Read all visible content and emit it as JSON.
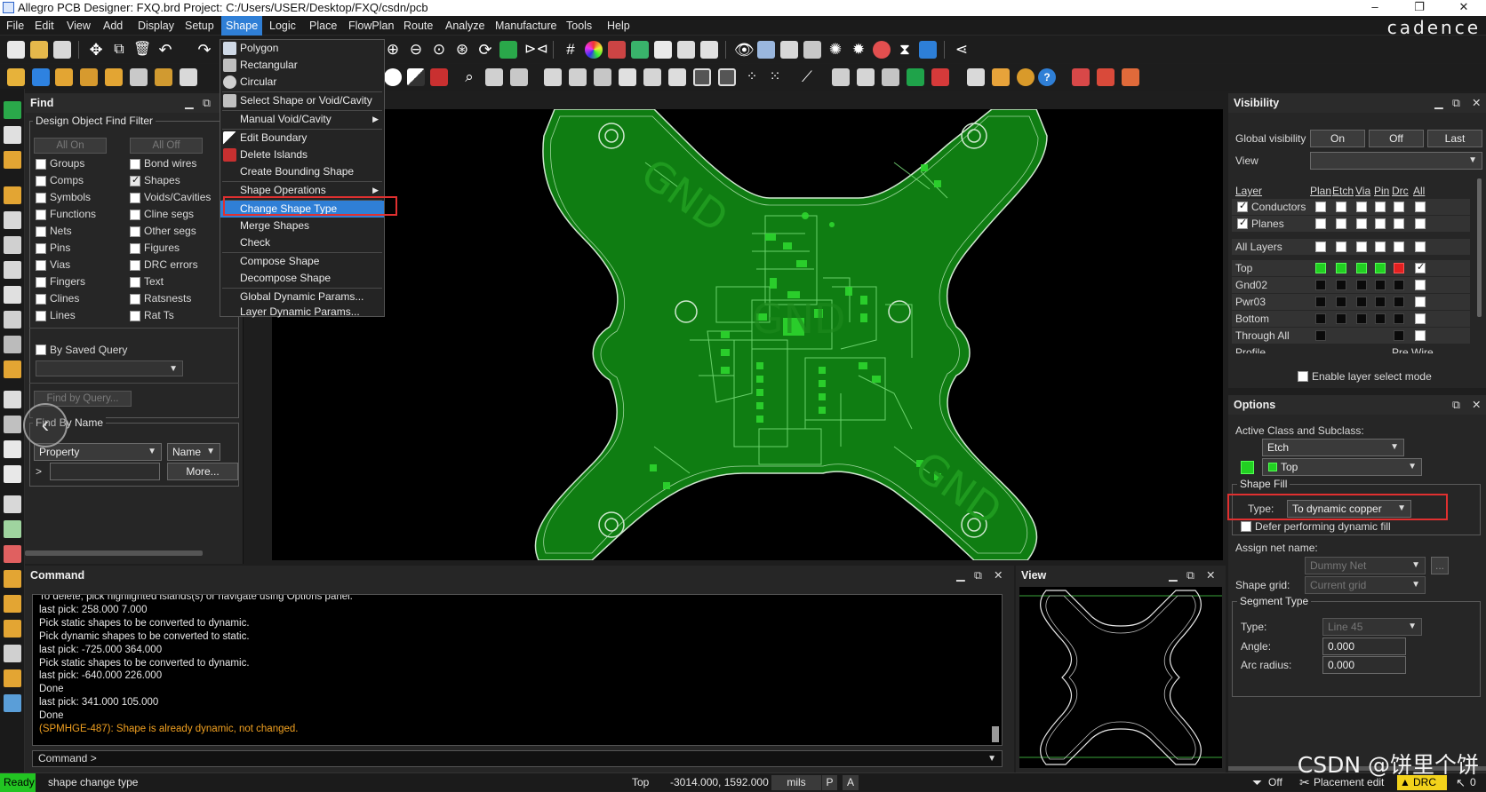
{
  "window": {
    "title": "Allegro PCB Designer: FXQ.brd  Project: C:/Users/USER/Desktop/FXQ/csdn/pcb",
    "minimize": "–",
    "restore": "❐",
    "close": "✕"
  },
  "menubar": {
    "items": [
      "File",
      "Edit",
      "View",
      "Add",
      "Display",
      "Setup",
      "Shape",
      "Logic",
      "Place",
      "FlowPlan",
      "Route",
      "Analyze",
      "Manufacture",
      "Tools",
      "Help"
    ],
    "active": "Shape",
    "brand": "cadence"
  },
  "shape_menu": {
    "items": [
      {
        "label": "Polygon"
      },
      {
        "label": "Rectangular"
      },
      {
        "label": "Circular"
      },
      {
        "label": "Select Shape or Void/Cavity"
      },
      {
        "label": "Manual Void/Cavity"
      },
      {
        "label": "Edit Boundary"
      },
      {
        "label": "Delete Islands"
      },
      {
        "label": "Create Bounding Shape"
      },
      {
        "label": "Shape Operations"
      },
      {
        "label": "Change Shape Type"
      },
      {
        "label": "Merge Shapes"
      },
      {
        "label": "Check"
      },
      {
        "label": "Compose Shape"
      },
      {
        "label": "Decompose Shape"
      },
      {
        "label": "Global Dynamic Params..."
      },
      {
        "label": "Layer Dynamic Params..."
      }
    ],
    "selected": "Change Shape Type"
  },
  "find": {
    "title": "Find",
    "filter_legend": "Design Object Find Filter",
    "all_on": "All On",
    "all_off": "All Off",
    "left_items": [
      "Groups",
      "Comps",
      "Symbols",
      "Functions",
      "Nets",
      "Pins",
      "Vias",
      "Fingers",
      "Clines",
      "Lines"
    ],
    "right_items": [
      "Bond wires",
      "Shapes",
      "Voids/Cavities",
      "Cline segs",
      "Other segs",
      "Figures",
      "DRC errors",
      "Text",
      "Ratsnests",
      "Rat Ts"
    ],
    "checked": [
      "Shapes"
    ],
    "by_saved_query": "By Saved Query",
    "find_by_query": "Find by Query...",
    "find_by_name_legend": "Find By Name",
    "property": "Property",
    "name": "Name",
    "prompt": ">",
    "more": "More..."
  },
  "visibility": {
    "title": "Visibility",
    "global_label": "Global visibility",
    "on": "On",
    "off": "Off",
    "last": "Last",
    "view_label": "View",
    "columns": [
      "Layer",
      "Plan",
      "Etch",
      "Via",
      "Pin",
      "Drc",
      "All"
    ],
    "rows": [
      {
        "name": "Conductors",
        "checked": true
      },
      {
        "name": "Planes",
        "checked": true
      },
      {
        "name": "All Layers"
      },
      {
        "name": "Top"
      },
      {
        "name": "Gnd02"
      },
      {
        "name": "Pwr03"
      },
      {
        "name": "Bottom"
      },
      {
        "name": "Through All"
      }
    ],
    "partial_row_left": "Profile",
    "partial_row_right": "Pre Wire",
    "enable_layer_select": "Enable layer select mode"
  },
  "options": {
    "title": "Options",
    "active_class_label": "Active Class and Subclass:",
    "class_value": "Etch",
    "subclass_value": "Top",
    "shape_fill_legend": "Shape Fill",
    "type_label": "Type:",
    "type_value": "To dynamic copper",
    "defer_label": "Defer performing dynamic fill",
    "assign_net_label": "Assign net name:",
    "net_value": "Dummy Net",
    "net_button": "...",
    "shape_grid_label": "Shape grid:",
    "grid_value": "Current grid",
    "segment_legend": "Segment Type",
    "seg_type_label": "Type:",
    "seg_type_value": "Line 45",
    "angle_label": "Angle:",
    "angle_value": "0.000",
    "arc_label": "Arc radius:",
    "arc_value": "0.000"
  },
  "command": {
    "title": "Command",
    "lines": [
      "To delete, pick highlighted islands(s) or navigate using Options panel.",
      "last pick:  258.000 7.000",
      "Pick static shapes to be converted to dynamic.",
      "Pick dynamic shapes to be converted to static.",
      "last pick:  -725.000 364.000",
      "Pick static shapes to be converted to dynamic.",
      "last pick:  -640.000 226.000",
      "Done",
      "last pick:  341.000 105.000",
      "Done"
    ],
    "warning": "(SPMHGE-487): Shape is already dynamic, not changed.",
    "prompt": "Command >"
  },
  "view_panel": {
    "title": "View"
  },
  "status": {
    "state": "Ready",
    "command": "shape change type",
    "layer": "Top",
    "coords": "-3014.000, 1592.000",
    "units": "mils",
    "p": "P",
    "a": "A",
    "off": "Off",
    "mode": "Placement edit",
    "drc": "DRC",
    "count": "0"
  },
  "board_text": {
    "top_left": "GND",
    "bottom_right": "GND",
    "center": "GND"
  },
  "watermark": "CSDN @饼里个饼",
  "colors": {
    "accent": "#2f7fd6",
    "copper": "#0f8a0f",
    "highlight_box": "#e03030",
    "warning": "#f0a020"
  }
}
